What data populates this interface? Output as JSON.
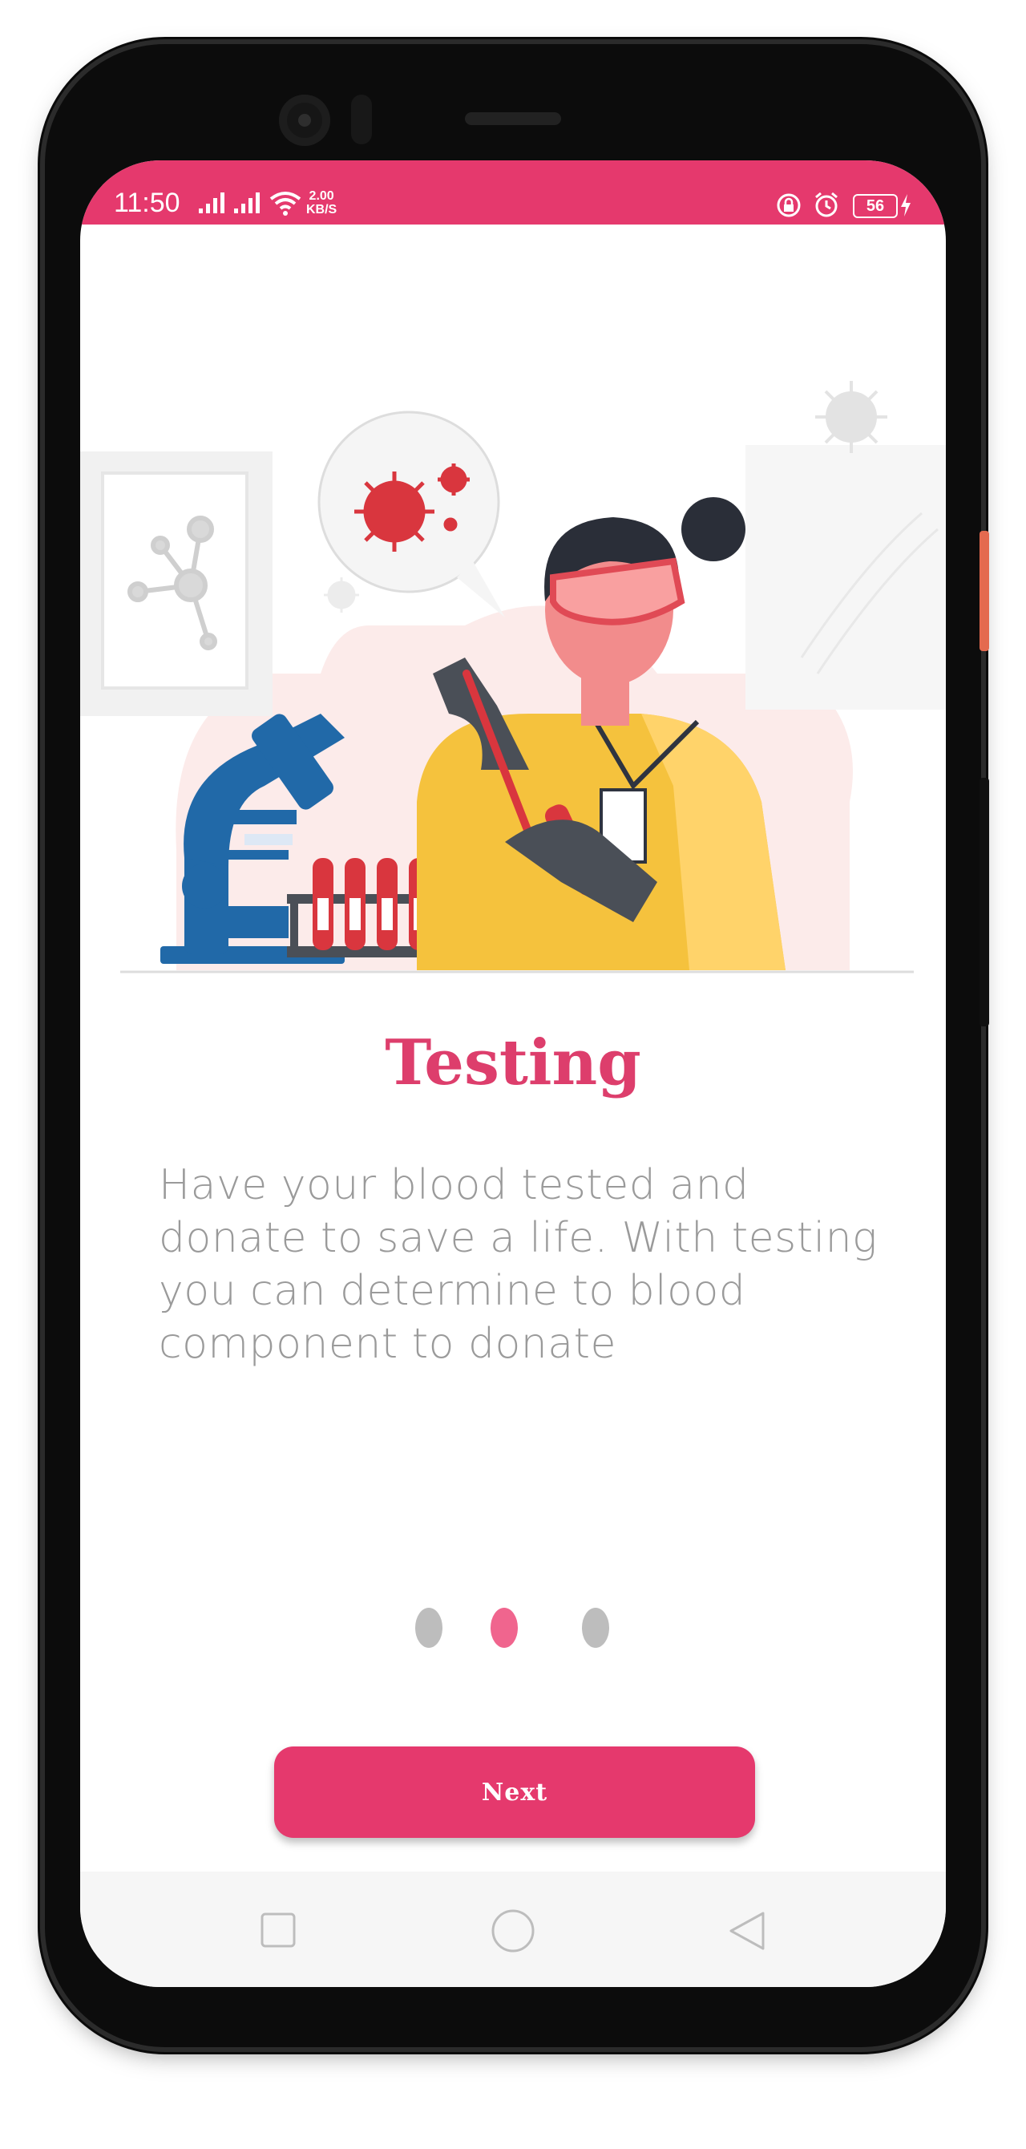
{
  "status_bar": {
    "time": "11:50",
    "net_speed_value": "2.00",
    "net_speed_unit": "KB/S",
    "battery": "56",
    "color": "#e5396d"
  },
  "onboarding": {
    "title": "Testing",
    "description": "Have your blood tested and donate to save a life. With testing you can determine to blood component to donate",
    "page_indicator": {
      "total": 3,
      "active_index": 1,
      "active_color": "#f0658e",
      "inactive_color": "#bdbdbd"
    },
    "next_label": "Next"
  },
  "nav_bar": {
    "recents_icon": "square-icon",
    "home_icon": "circle-icon",
    "back_icon": "triangle-back-icon"
  },
  "colors": {
    "accent": "#e5396d",
    "title": "#dd3e6c",
    "text": "#9a9a9a"
  }
}
